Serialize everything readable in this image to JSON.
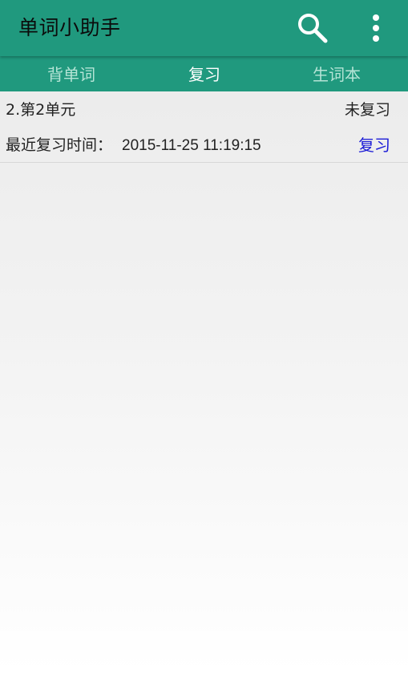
{
  "app": {
    "title": "单词小助手",
    "bar_color": "#20997e"
  },
  "toolbar": {
    "search_icon": "search-icon",
    "more_icon": "more-vertical-icon"
  },
  "tabs": [
    {
      "label": "背单词",
      "selected": false
    },
    {
      "label": "复习",
      "selected": true
    },
    {
      "label": "生词本",
      "selected": false
    }
  ],
  "review_list": [
    {
      "unit": "2.第2单元",
      "status": "未复习",
      "last_review_label": "最近复习时间：",
      "last_review_time": "2015-11-25 11:19:15",
      "action_label": "复习",
      "action_color": "#1a1ad6"
    }
  ]
}
